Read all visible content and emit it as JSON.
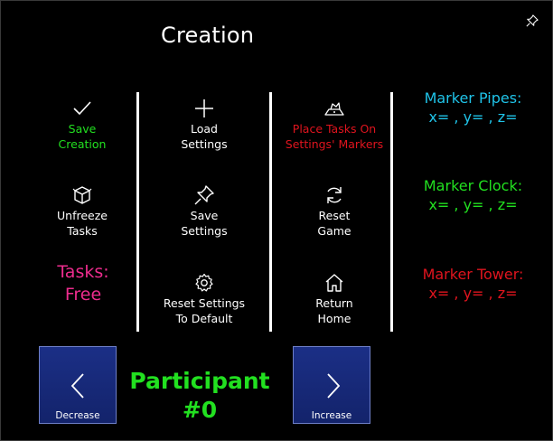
{
  "window": {
    "title": "Creation",
    "pin_icon": "pin-icon"
  },
  "colors": {
    "green": "#22e020",
    "red": "#e0141e",
    "cyan": "#1fc3e8",
    "pink": "#ee2c8e",
    "nav_blue": "#1b2f86"
  },
  "actions": {
    "save_creation": {
      "label": "Save\nCreation",
      "icon": "checkmark-icon"
    },
    "unfreeze_tasks": {
      "label": "Unfreeze\nTasks",
      "icon": "cube-icon"
    },
    "load_settings": {
      "label": "Load\nSettings",
      "icon": "plus-icon"
    },
    "save_settings": {
      "label": "Save\nSettings",
      "icon": "pin-icon"
    },
    "reset_settings_default": {
      "label": "Reset Settings\nTo Default",
      "icon": "gear-icon"
    },
    "place_tasks": {
      "label": "Place Tasks On\nSettings' Markers",
      "icon": "map-icon"
    },
    "reset_game": {
      "label": "Reset\nGame",
      "icon": "refresh-icon"
    },
    "return_home": {
      "label": "Return\nHome",
      "icon": "home-icon"
    }
  },
  "tasks": {
    "label": "Tasks:",
    "value": "Free"
  },
  "markers": [
    {
      "name": "Marker Pipes:",
      "coords": "x= , y= , z="
    },
    {
      "name": "Marker Clock:",
      "coords": "x= , y= , z="
    },
    {
      "name": "Marker Tower:",
      "coords": "x= , y= , z="
    }
  ],
  "participant": {
    "label": "Participant",
    "number": "#0"
  },
  "nav": {
    "decrease_label": "Decrease",
    "increase_label": "Increase"
  }
}
